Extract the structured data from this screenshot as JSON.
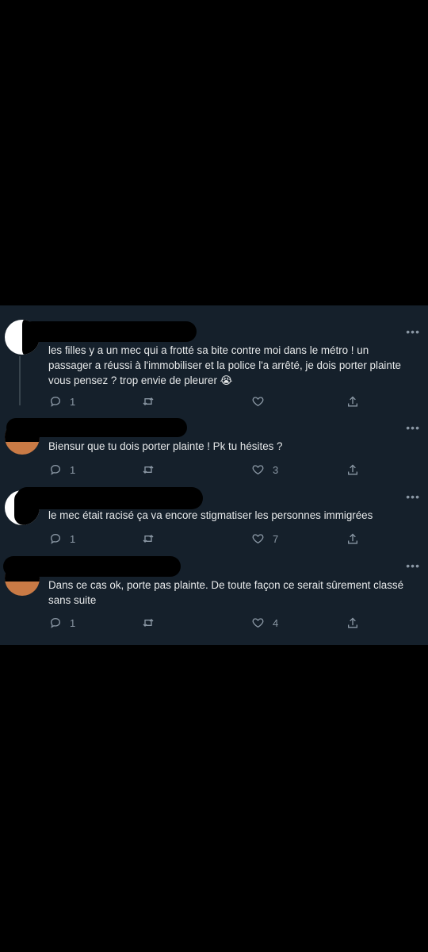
{
  "colors": {
    "background": "#000000",
    "panel": "#15202b",
    "text": "#e7e9ea",
    "muted": "#8b98a5"
  },
  "tweets": [
    {
      "text_lines": [
        "les filles y a un mec qui a frotté sa bite contre moi dans le métro ! un",
        "passager a réussi à l'immobiliser et la police l'a arrêté, je dois porter plainte",
        "vous pensez ? trop envie de pleurer 😭"
      ],
      "replies": "1",
      "retweets": "",
      "likes": ""
    },
    {
      "text_lines": [
        "Biensur que tu dois porter plainte ! Pk tu hésites ?"
      ],
      "replies": "1",
      "retweets": "",
      "likes": "3"
    },
    {
      "text_lines": [
        "le mec était racisé ça va encore stigmatiser les personnes immigrées"
      ],
      "replies": "1",
      "retweets": "",
      "likes": "7"
    },
    {
      "text_lines": [
        "Dans ce cas ok, porte pas plainte. De toute façon ce serait sûrement classé",
        "sans suite"
      ],
      "replies": "1",
      "retweets": "",
      "likes": "4"
    }
  ],
  "icons": {
    "more": "more-horizontal-icon",
    "reply": "reply-icon",
    "retweet": "retweet-icon",
    "like": "heart-icon",
    "share": "share-icon"
  },
  "more_glyph": "•••"
}
